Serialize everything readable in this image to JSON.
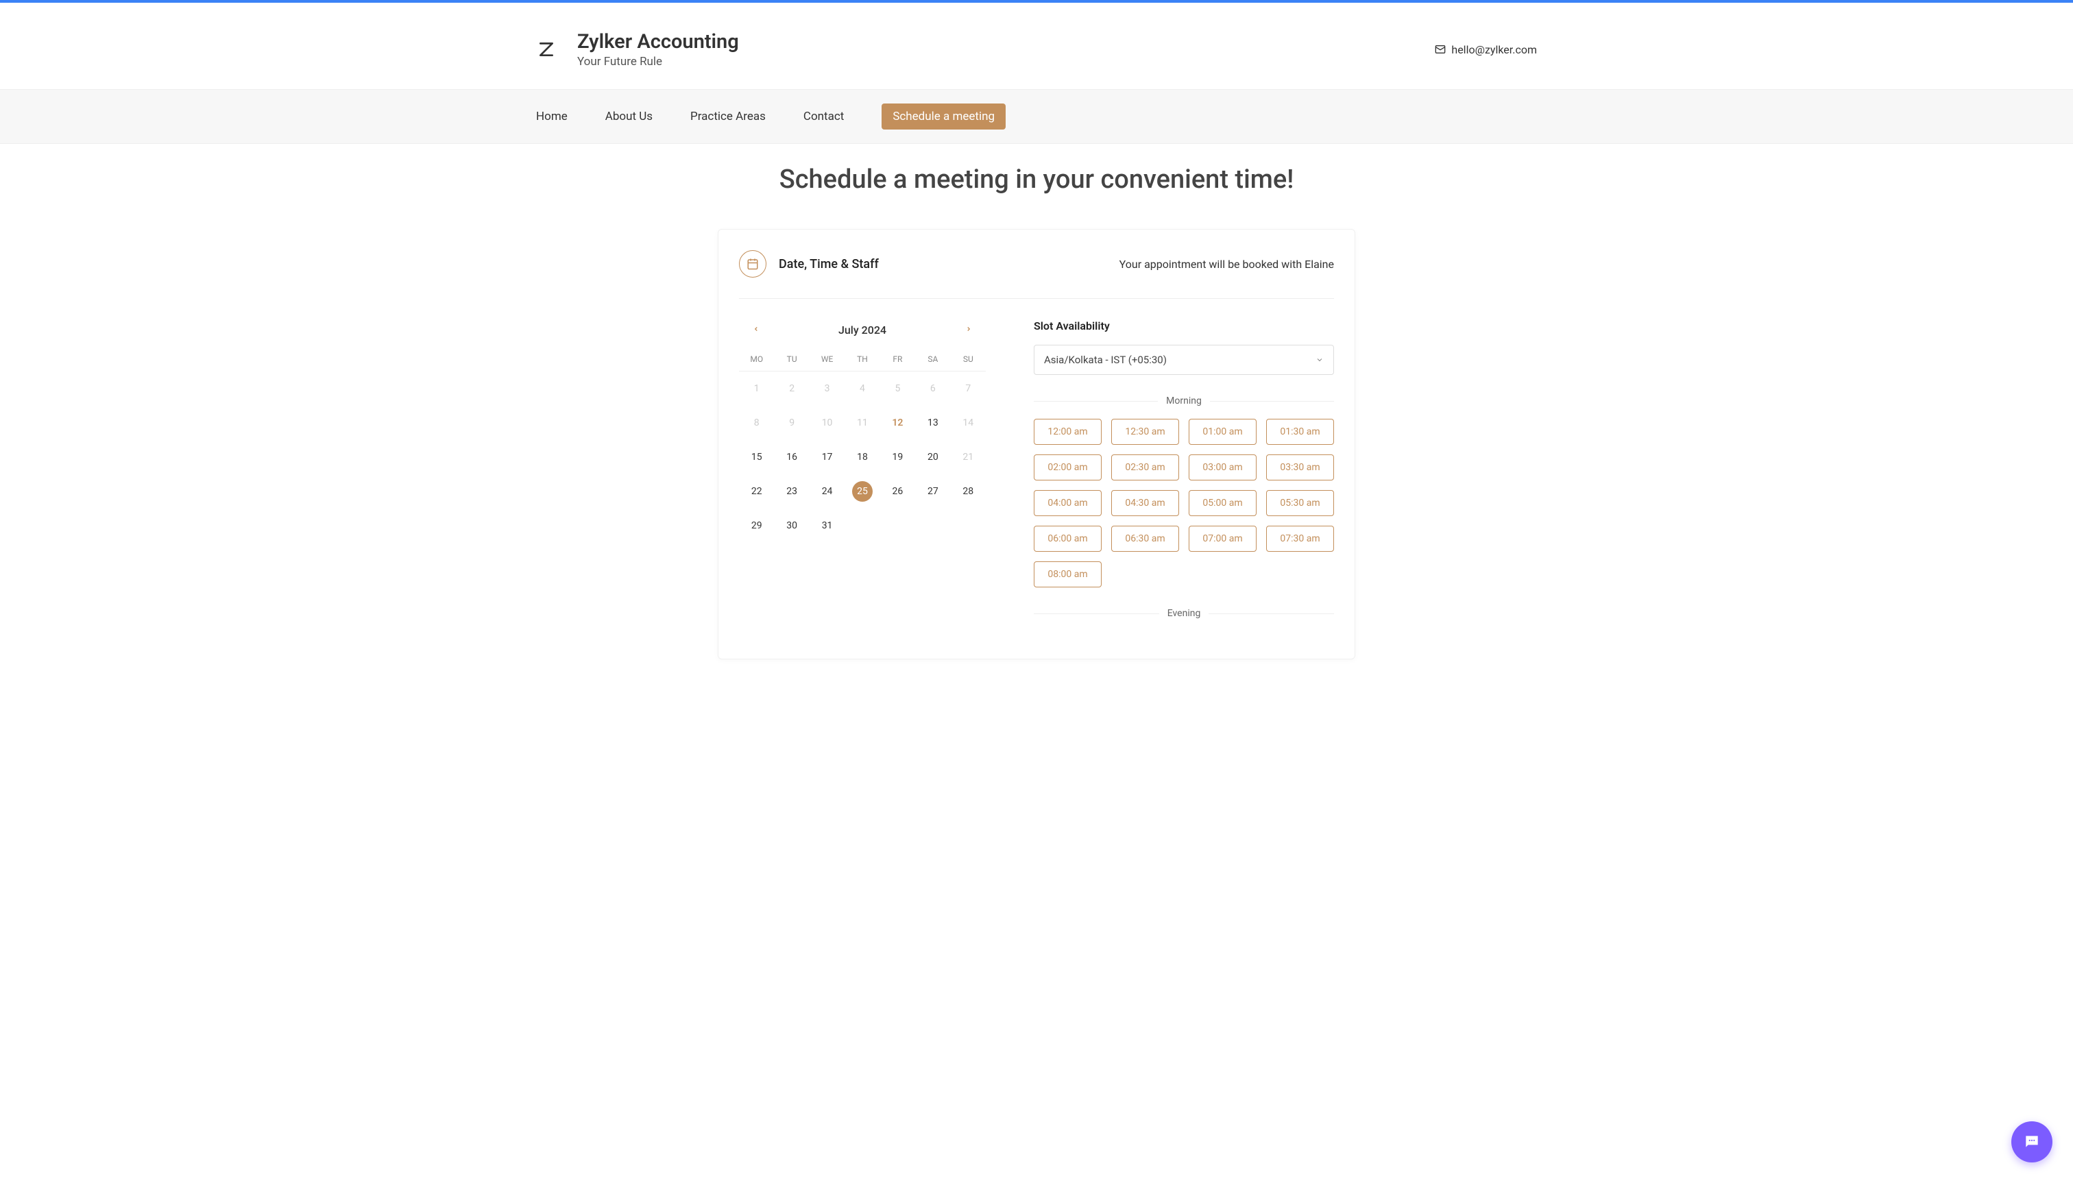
{
  "accent_color": "#c38f5b",
  "brand": {
    "name": "Zylker Accounting",
    "tagline": "Your Future Rule"
  },
  "contact_email": "hello@zylker.com",
  "nav": {
    "items": [
      {
        "label": "Home",
        "active": false
      },
      {
        "label": "About Us",
        "active": false
      },
      {
        "label": "Practice Areas",
        "active": false
      },
      {
        "label": "Contact",
        "active": false
      },
      {
        "label": "Schedule a meeting",
        "active": true
      }
    ]
  },
  "hero": {
    "title": "Schedule a meeting in your convenient time!"
  },
  "panel": {
    "header_title": "Date, Time & Staff",
    "staff_note": "Your appointment will be booked with Elaine"
  },
  "calendar": {
    "month_label": "July 2024",
    "dow": [
      "MO",
      "TU",
      "WE",
      "TH",
      "FR",
      "SA",
      "SU"
    ],
    "cells": [
      {
        "n": "1",
        "state": "disabled"
      },
      {
        "n": "2",
        "state": "disabled"
      },
      {
        "n": "3",
        "state": "disabled"
      },
      {
        "n": "4",
        "state": "disabled"
      },
      {
        "n": "5",
        "state": "disabled"
      },
      {
        "n": "6",
        "state": "disabled"
      },
      {
        "n": "7",
        "state": "disabled"
      },
      {
        "n": "8",
        "state": "disabled"
      },
      {
        "n": "9",
        "state": "disabled"
      },
      {
        "n": "10",
        "state": "disabled"
      },
      {
        "n": "11",
        "state": "disabled"
      },
      {
        "n": "12",
        "state": "today"
      },
      {
        "n": "13",
        "state": "normal"
      },
      {
        "n": "14",
        "state": "disabled"
      },
      {
        "n": "15",
        "state": "normal"
      },
      {
        "n": "16",
        "state": "normal"
      },
      {
        "n": "17",
        "state": "normal"
      },
      {
        "n": "18",
        "state": "normal"
      },
      {
        "n": "19",
        "state": "normal"
      },
      {
        "n": "20",
        "state": "normal"
      },
      {
        "n": "21",
        "state": "disabled"
      },
      {
        "n": "22",
        "state": "normal"
      },
      {
        "n": "23",
        "state": "normal"
      },
      {
        "n": "24",
        "state": "normal"
      },
      {
        "n": "25",
        "state": "selected"
      },
      {
        "n": "26",
        "state": "normal"
      },
      {
        "n": "27",
        "state": "normal"
      },
      {
        "n": "28",
        "state": "normal"
      },
      {
        "n": "29",
        "state": "normal"
      },
      {
        "n": "30",
        "state": "normal"
      },
      {
        "n": "31",
        "state": "normal"
      }
    ]
  },
  "slots": {
    "title": "Slot Availability",
    "timezone": "Asia/Kolkata - IST (+05:30)",
    "sections": [
      {
        "label": "Morning",
        "times": [
          "12:00 am",
          "12:30 am",
          "01:00 am",
          "01:30 am",
          "02:00 am",
          "02:30 am",
          "03:00 am",
          "03:30 am",
          "04:00 am",
          "04:30 am",
          "05:00 am",
          "05:30 am",
          "06:00 am",
          "06:30 am",
          "07:00 am",
          "07:30 am",
          "08:00 am"
        ]
      },
      {
        "label": "Evening",
        "times": []
      }
    ]
  }
}
